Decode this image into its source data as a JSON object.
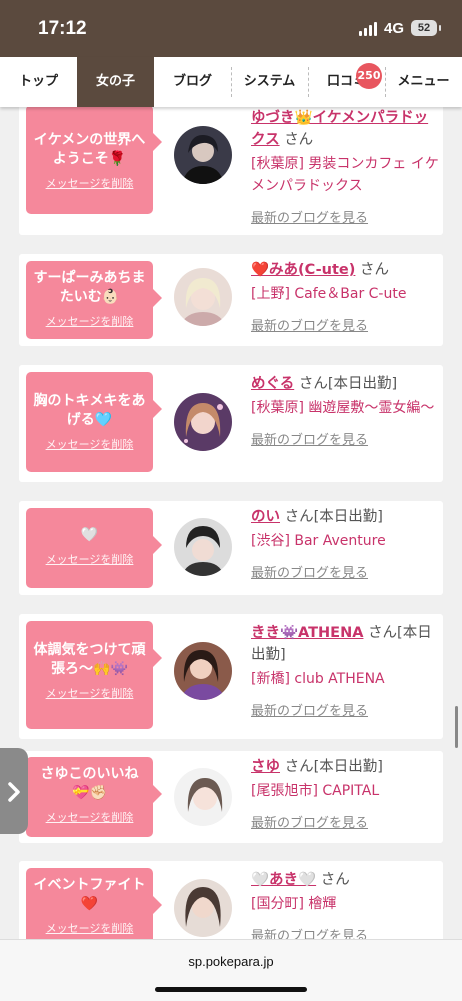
{
  "status": {
    "time": "17:12",
    "network": "4G",
    "battery": "52"
  },
  "nav": {
    "tabs": [
      {
        "label": "トップ"
      },
      {
        "label": "女の子"
      },
      {
        "label": "ブログ"
      },
      {
        "label": "システム"
      },
      {
        "label": "口コミ"
      },
      {
        "label": "メニュー"
      }
    ],
    "active_index": 1,
    "review_badge": "250"
  },
  "cards": [
    {
      "message": "イケメンの世界へようこそ🌹",
      "delete_label": "メッセージを削除",
      "name": "ゆづき👑イケメンパラドックス",
      "suffix": "さん",
      "shop": "[秋葉原] 男装コンカフェ イケメンパラドックス",
      "blog_link": "最新のブログを見る"
    },
    {
      "message": "すーぱーみあちまたいむ👶🏻",
      "delete_label": "メッセージを削除",
      "name": "❤️みあ(C-ute)",
      "suffix": "さん",
      "shop": "[上野] Cafe＆Bar C-ute",
      "blog_link": "最新のブログを見る"
    },
    {
      "message": "胸のトキメキをあげる🩵",
      "delete_label": "メッセージを削除",
      "name": "めぐる",
      "suffix": "さん[本日出勤]",
      "shop": "[秋葉原] 幽遊屋敷～霊女編～",
      "blog_link": "最新のブログを見る"
    },
    {
      "message": "🤍",
      "delete_label": "メッセージを削除",
      "name": "のい",
      "suffix": "さん[本日出勤]",
      "shop": "[渋谷] Bar Aventure",
      "blog_link": "最新のブログを見る"
    },
    {
      "message": "体調気をつけて頑張ろ～🙌👾",
      "delete_label": "メッセージを削除",
      "name": "きき👾ATHENA",
      "suffix": "さん[本日出勤]",
      "shop": "[新橋] club ATHENA",
      "blog_link": "最新のブログを見る"
    },
    {
      "message": "さゆこのいいね💝✊🏻",
      "delete_label": "メッセージを削除",
      "name": "さゆ",
      "suffix": "さん[本日出勤]",
      "shop": "[尾張旭市] CAPITAL",
      "blog_link": "最新のブログを見る"
    },
    {
      "message": "イベントファイト❤️",
      "delete_label": "メッセージを削除",
      "name": "🤍あき🤍",
      "suffix": "さん",
      "shop": "[国分町] 檜輝",
      "blog_link": "最新のブログを見る"
    }
  ],
  "url_bar": {
    "url": "sp.pokepara.jp"
  },
  "colors": {
    "accent_pink": "#c8336a",
    "bubble_pink": "#f5889b",
    "header_brown": "#5b4a3e",
    "badge_red": "#e8565f"
  },
  "icons": {
    "side_tab": "chevron-right-icon",
    "signal": "signal-icon"
  }
}
